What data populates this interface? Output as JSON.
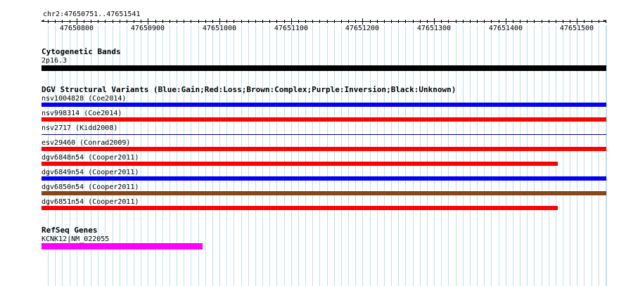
{
  "region": {
    "label": "chr2:47650751..47651541",
    "start": 47650751,
    "end": 47651541,
    "tick_labels": [
      "47650800",
      "47650900",
      "47651000",
      "47651100",
      "47651200",
      "47651300",
      "47651400",
      "47651500"
    ]
  },
  "tracks": {
    "cyto": {
      "title": "Cytogenetic Bands",
      "band": {
        "label": "2p16.3",
        "color": "#000000",
        "start": 47650751,
        "end": 47651541
      }
    },
    "dgv": {
      "title": "DGV Structural Variants (Blue:Gain;Red:Loss;Brown:Complex;Purple:Inversion;Black:Unknown)",
      "items": [
        {
          "label": "nsv1004828 (Coe2014)",
          "color": "#0000ff",
          "start": 47650751,
          "end": 47651541
        },
        {
          "label": "nsv998314 (Coe2014)",
          "color": "#ff0000",
          "start": 47650751,
          "end": 47651541
        },
        {
          "label": "nsv2717 (Kidd2008)",
          "color": "#000080",
          "start": 47650751,
          "end": 47651541
        },
        {
          "label": "esv29460 (Conrad2009)",
          "color": "#ff0000",
          "start": 47650751,
          "end": 47651541
        },
        {
          "label": "dgv6848n54 (Cooper2011)",
          "color": "#ff0000",
          "start": 47650751,
          "end": 47651473
        },
        {
          "label": "dgv6849n54 (Cooper2011)",
          "color": "#0000ff",
          "start": 47650751,
          "end": 47651541
        },
        {
          "label": "dgv6850n54 (Cooper2011)",
          "color": "#8b4513",
          "start": 47650751,
          "end": 47651541
        },
        {
          "label": "dgv6851n54 (Cooper2011)",
          "color": "#ff0000",
          "start": 47650751,
          "end": 47651473
        }
      ]
    },
    "refseq": {
      "title": "RefSeq Genes",
      "items": [
        {
          "label": "KCNK12|NM_022055",
          "color": "#ff00ff",
          "start": 47650751,
          "end": 47650976
        }
      ]
    }
  }
}
